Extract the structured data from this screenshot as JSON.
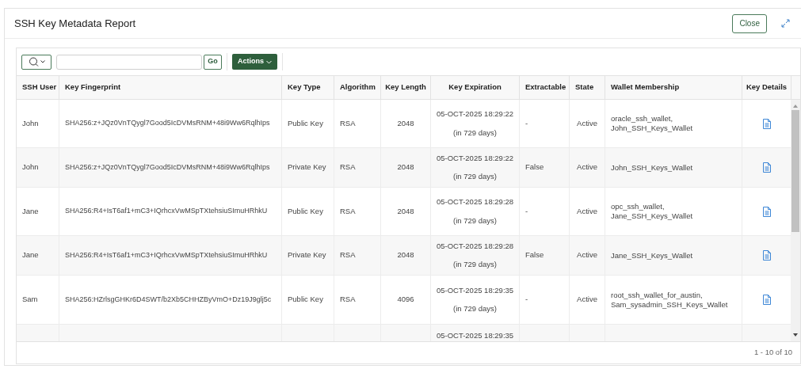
{
  "dialog": {
    "title": "SSH Key Metadata Report",
    "close_button": "Close"
  },
  "toolbar": {
    "go_button": "Go",
    "actions_button": "Actions"
  },
  "table": {
    "columns": [
      "SSH User",
      "Key Fingerprint",
      "Key Type",
      "Algorithm",
      "Key Length",
      "Key Expiration",
      "Extractable",
      "State",
      "Wallet Membership",
      "Key Details"
    ],
    "rows": [
      {
        "ssh_user": "John",
        "key_fingerprint": "SHA256:z+JQz0VnTQygl7Good5IcDVMsRNM+48i9Ww6RqlhIps",
        "key_type": "Public Key",
        "algorithm": "RSA",
        "key_length": "2048",
        "key_expiration": [
          "05-OCT-2025 18:29:22",
          "(in 729 days)"
        ],
        "extractable": "-",
        "state": "Active",
        "wallet_membership": [
          "oracle_ssh_wallet,",
          "John_SSH_Keys_Wallet"
        ],
        "key_details": true
      },
      {
        "ssh_user": "John",
        "key_fingerprint": "SHA256:z+JQz0VnTQygl7Good5IcDVMsRNM+48i9Ww6RqlhIps",
        "key_type": "Private Key",
        "algorithm": "RSA",
        "key_length": "2048",
        "key_expiration": [
          "05-OCT-2025 18:29:22",
          "(in 729 days)"
        ],
        "extractable": "False",
        "state": "Active",
        "wallet_membership": [
          "John_SSH_Keys_Wallet"
        ],
        "key_details": true
      },
      {
        "ssh_user": "Jane",
        "key_fingerprint": "SHA256:R4+IsT6af1+mC3+IQrhcxVwMSpTXtehsiuSImuHRhkU",
        "key_type": "Public Key",
        "algorithm": "RSA",
        "key_length": "2048",
        "key_expiration": [
          "05-OCT-2025 18:29:28",
          "(in 729 days)"
        ],
        "extractable": "-",
        "state": "Active",
        "wallet_membership": [
          "opc_ssh_wallet,",
          "Jane_SSH_Keys_Wallet"
        ],
        "key_details": true
      },
      {
        "ssh_user": "Jane",
        "key_fingerprint": "SHA256:R4+IsT6af1+mC3+IQrhcxVwMSpTXtehsiuSImuHRhkU",
        "key_type": "Private Key",
        "algorithm": "RSA",
        "key_length": "2048",
        "key_expiration": [
          "05-OCT-2025 18:29:28",
          "(in 729 days)"
        ],
        "extractable": "False",
        "state": "Active",
        "wallet_membership": [
          "Jane_SSH_Keys_Wallet"
        ],
        "key_details": true
      },
      {
        "ssh_user": "Sam",
        "key_fingerprint": "SHA256:HZrlsgGHKr6D4SWT/b2Xb5CHHZByVmO+Dz19J9glj5c",
        "key_type": "Public Key",
        "algorithm": "RSA",
        "key_length": "4096",
        "key_expiration": [
          "05-OCT-2025 18:29:35",
          "(in 729 days)"
        ],
        "extractable": "-",
        "state": "Active",
        "wallet_membership": [
          "root_ssh_wallet_for_austin,",
          "Sam_sysadmin_SSH_Keys_Wallet"
        ],
        "key_details": true
      },
      {
        "key_expiration": [
          "05-OCT-2025 18:29:35"
        ]
      }
    ]
  },
  "pagination": "1 - 10 of 10"
}
